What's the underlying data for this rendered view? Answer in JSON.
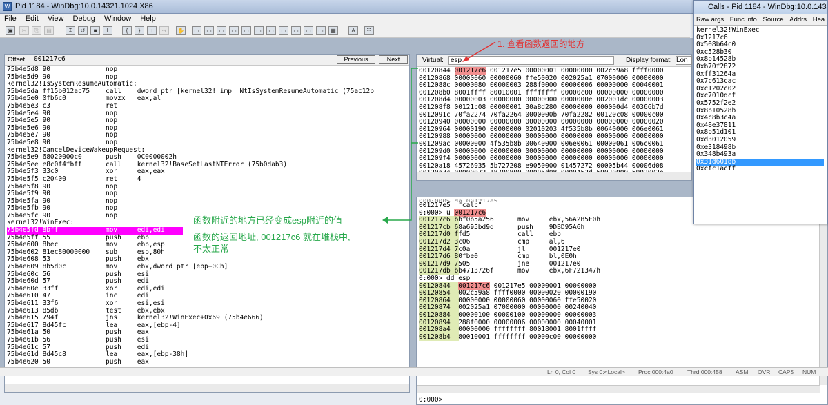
{
  "window": {
    "title": "Pid 1184 - WinDbg:10.0.14321.1024 X86"
  },
  "menu": [
    "File",
    "Edit",
    "View",
    "Debug",
    "Window",
    "Help"
  ],
  "disasm": {
    "offset_label": "Offset:",
    "offset_value": "001217c6",
    "previous_label": "Previous",
    "next_label": "Next",
    "lines_before": "75b4e5d8 90              nop\n75b4e5d9 90              nop\nkernel32!IsSystemResumeAutomatic:\n75b4e5da ff15b012ac75    call    dword ptr [kernel32!_imp__NtIsSystemResumeAutomatic (75ac12b\n75b4e5e0 0fb6c0          movzx   eax,al\n75b4e5e3 c3              ret\n75b4e5e4 90              nop\n75b4e5e5 90              nop\n75b4e5e6 90              nop\n75b4e5e7 90              nop\n75b4e5e8 90              nop\nkernel32!CancelDeviceWakeupRequest:\n75b4e5e9 68020000c0      push    0C0000002h\n75b4e5ee e8c0f4fbff      call    kernel32!BaseSetLastNTError (75b0dab3)\n75b4e5f3 33c0            xor     eax,eax\n75b4e5f5 c20400          ret     4\n75b4e5f8 90              nop\n75b4e5f9 90              nop\n75b4e5fa 90              nop\n75b4e5fb 90              nop\n75b4e5fc 90              nop\nkernel32!WinExec:",
    "highlight": "75b4e5fd 8bff            mov     edi,edi",
    "lines_after": "75b4e5ff 55              push    ebp\n75b4e600 8bec            mov     ebp,esp\n75b4e602 81ec80000000    sub     esp,80h\n75b4e608 53              push    ebx\n75b4e609 8b5d0c          mov     ebx,dword ptr [ebp+0Ch]\n75b4e60c 56              push    esi\n75b4e60d 57              push    edi\n75b4e60e 33ff            xor     edi,edi\n75b4e610 47              inc     edi\n75b4e611 33f6            xor     esi,esi\n75b4e613 85db            test    ebx,ebx\n75b4e615 794f            jns     kernel32!WinExec+0x69 (75b4e666)\n75b4e617 8d45fc          lea     eax,[ebp-4]\n75b4e61a 50              push    eax\n75b4e61b 56              push    esi\n75b4e61c 57              push    edi\n75b4e61d 8d45c8          lea     eax,[ebp-38h]\n75b4e620 50              push    eax"
  },
  "memory": {
    "virtual_label": "Virtual:",
    "virtual_value": "esp",
    "display_format_label": "Display format:",
    "display_format_value": "Lon",
    "first_addr": "00120844",
    "first_highlight": "001217c6",
    "first_rest": " 001217e5 00000001 00000000 002c59a8 ffff0000",
    "lines": "00120868 00000060 00000060 ffe50020 002025a1 07000000 00000000\n0012088c 00000080 00000003 288f0000 00000006 00000000 00040001\n001208b0 8001ffff 80010001 ffffffff 00000c00 00000000 00000000\n001208d4 00000003 00000000 00000000 0000000e 002001dc 00000003\n001208f8 00121c08 00000001 30a8d280 00000000 000000d4 00366b7d\n0012091c 70fa2274 70fa2264 0000000b 70fa2282 00120c08 00000c00\n00120940 00000000 00000000 00000000 00000000 00000000 00000020\n00120964 00000190 00000000 02010203 4f535b8b 00640000 006e0061\n00120988 00000000 00000000 00000000 00000000 00000000 00000000\n001209ac 00000000 4f535b8b 00640000 006e0061 00000061 006c0061\n001209d0 00000000 00000000 00000000 00000000 00000000 00000000\n001209f4 00000000 00000000 00000000 00000000 00000000 00000000\n00120a18 45726935 5b727208 e9050000 01457272 00005b44 00006d08\n00120a3c 00000072 18700800 00096d08 0000452d 59020000 5902002e"
  },
  "command": {
    "top_partial": "000:000> da 001217e5",
    "line1": "001217e5  \"calc\"",
    "prompt_u": "0:000> u 001217c6",
    "u_prompt_prefix": "0:000> u ",
    "u_prompt_addr": "001217c6",
    "u_lines": "001217c6 bbf0b5a256      mov     ebx,56A2B5F0h\n001217cb 68a695bd9d      push    9DBD95A6h\n001217d0 ffd5            call    ebp\n001217d2 3c06            cmp     al,6\n001217d4 7c0a            jl      001217e0\n001217d6 80fbe0          cmp     bl,0E0h\n001217d9 7505            jne     001217e0\n001217db bb4713726f      mov     ebx,6F721347h",
    "dd_prompt": "0:000> dd esp",
    "dd_first_addr": "00120844",
    "dd_first_highlight": "001217c6",
    "dd_first_rest": " 001217e5 00000001 00000000",
    "dd_lines": "00120854  002c59a8 ffff0000 00000020 00000190\n00120864  00000000 00000060 00000060 ffe50020\n00120874  002025a1 07000000 00000000 00240040\n00120884  00000100 00000100 00000000 00000003\n00120894  288f0000 00000006 00000000 00040001\n001208a4  00000000 ffffffff 80018001 8001ffff\n001208b4  80010001 ffffffff 00000c00 00000000",
    "input_prompt": "0:000>"
  },
  "calls": {
    "title": "Calls - Pid 1184 - WinDbg:10.0.14321.1024",
    "buttons": [
      "Raw args",
      "Func info",
      "Source",
      "Addrs",
      "Hea"
    ],
    "items": [
      "kernel32!WinExec",
      "0x1217c6",
      "0x508b64c0",
      "0xc528b30",
      "0x8b14528b",
      "0xb70f2872",
      "0xff31264a",
      "0x7c613cac",
      "0xc1202c02",
      "0xc7010dcf",
      "0x5752f2e2",
      "0x8b10528b",
      "0x4c8b3c4a",
      "0x48e37811",
      "0x8b51d101",
      "0xd3012059",
      "0xe318498b",
      "0x348b493a",
      "0x31d6018b",
      "0xcfc1acff"
    ],
    "selected_index": 18
  },
  "annotations": {
    "arrow_note": "1. 查看函数返回的地方",
    "note1": "函数附近的地方已经变成esp附近的值",
    "note2": "函数的返回地址, 001217c6 就在堆栈中,\n不太正常"
  },
  "status": {
    "ln_col": "Ln 0, Col 0",
    "sys": "Sys 0:<Local>",
    "proc": "Proc 000:4a0",
    "thrd": "Thrd 000:458",
    "asm": "ASM",
    "ovr": "OVR",
    "caps": "CAPS",
    "num": "NUM"
  },
  "colors": {
    "annotation_green": "#28a84b",
    "annotation_red": "#e23434",
    "highlight_magenta": "#ff00ff",
    "highlight_red": "#f28f8f",
    "selection_blue": "#3399ff"
  }
}
